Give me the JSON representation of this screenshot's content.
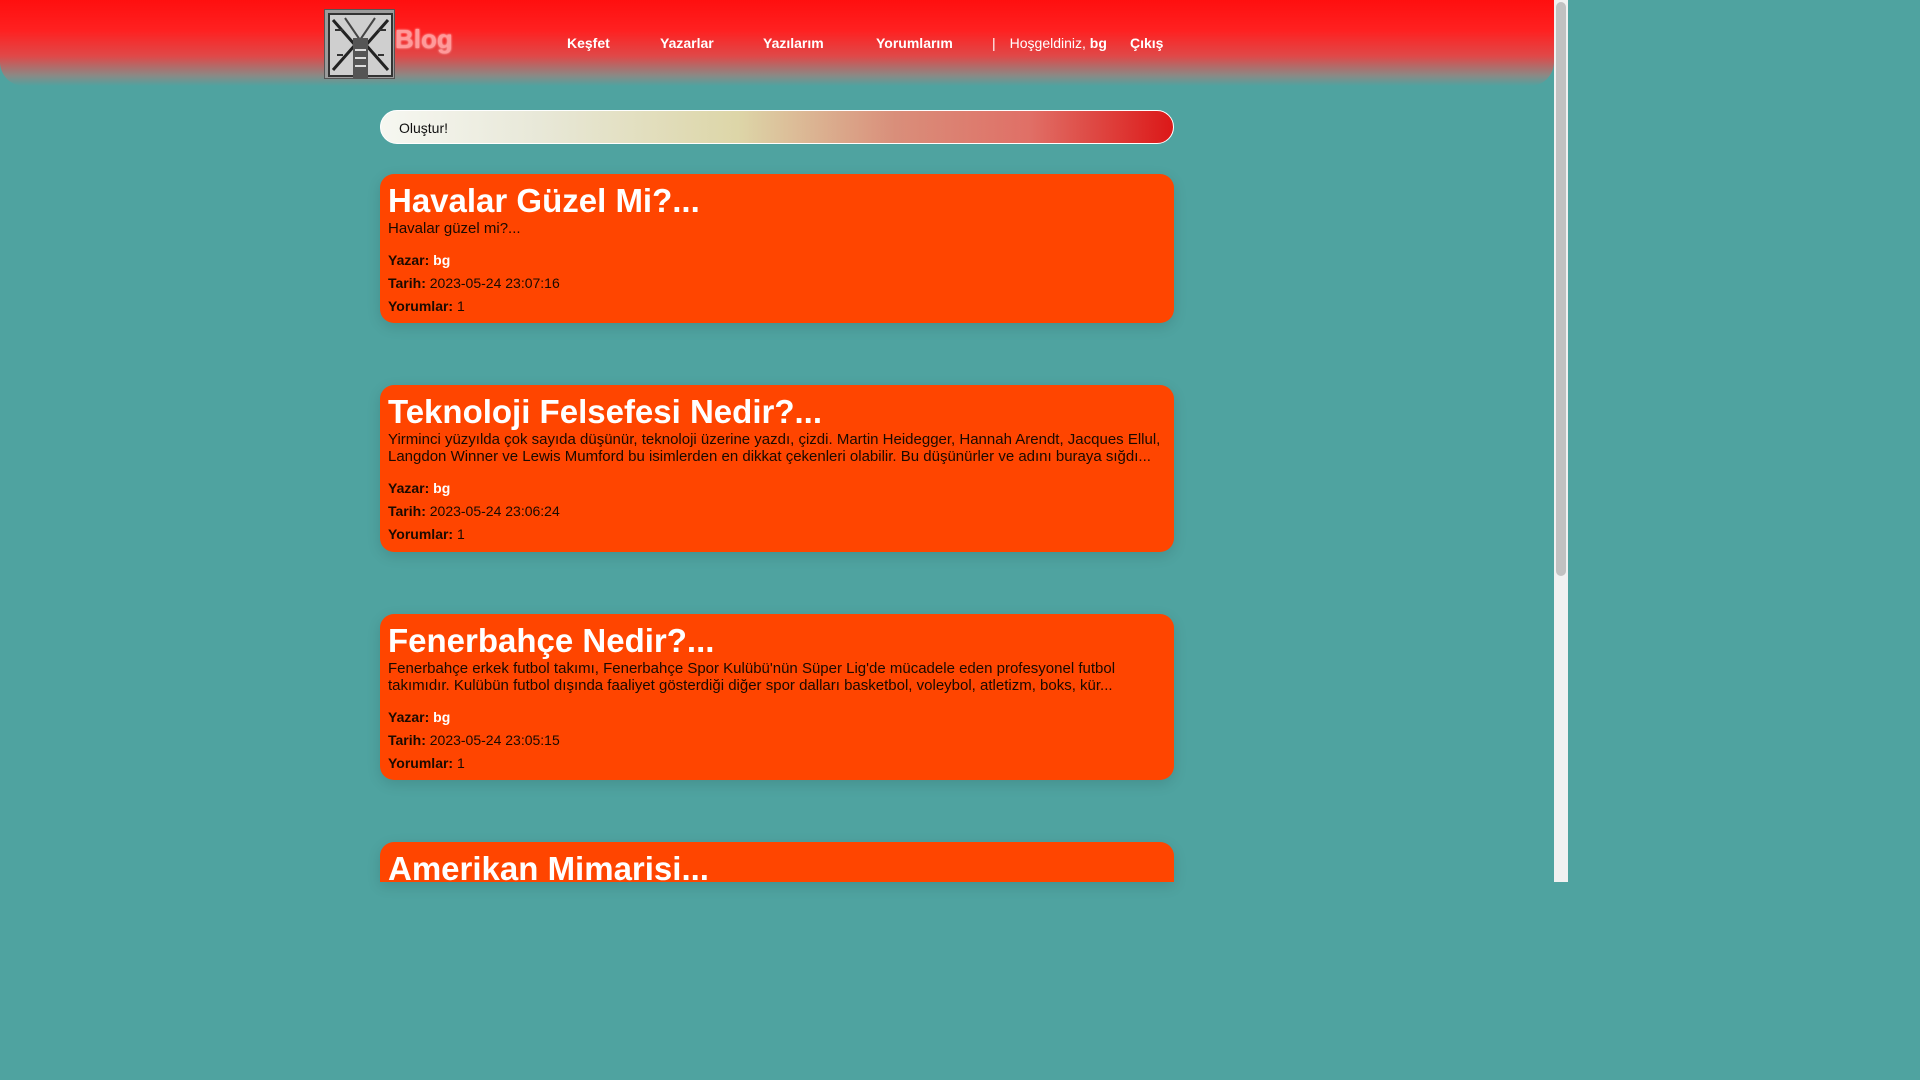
{
  "header": {
    "logo_text": "Blog",
    "nav": [
      "Keşfet",
      "Yazarlar",
      "Yazılarım",
      "Yorumlarım"
    ],
    "separator": "|",
    "welcome_prefix": "Hoşgeldiniz,",
    "welcome_user": "bg",
    "logout": "Çıkış"
  },
  "create": {
    "label": "Oluştur!"
  },
  "labels": {
    "author": "Yazar:",
    "date": "Tarih:",
    "comments": "Yorumlar:"
  },
  "posts": [
    {
      "title": "Havalar Güzel Mi?...",
      "excerpt": "Havalar güzel mi?...",
      "author": "bg",
      "date": "2023-05-24 23:07:16",
      "comments": "1"
    },
    {
      "title": "Teknoloji Felsefesi Nedir?...",
      "excerpt": "Yirminci yüzyılda çok sayıda düşünür, teknoloji üzerine yazdı, çizdi. Martin Heidegger, Hannah Arendt, Jacques Ellul, Langdon Winner ve Lewis Mumford bu isimlerden en dikkat çekenleri olabilir. Bu düşünürler ve adını buraya sığdı...",
      "author": "bg",
      "date": "2023-05-24 23:06:24",
      "comments": "1"
    },
    {
      "title": "Fenerbahçe Nedir?...",
      "excerpt": "Fenerbahçe erkek futbol takımı, Fenerbahçe Spor Kulübü'nün Süper Lig'de mücadele eden profesyonel futbol takımıdır. Kulübün futbol dışında faaliyet gösterdiği diğer spor dalları basketbol, voleybol, atletizm, boks, kür...",
      "author": "bg",
      "date": "2023-05-24 23:05:15",
      "comments": "1"
    },
    {
      "title": "Amerikan Mimarisi..."
    }
  ]
}
